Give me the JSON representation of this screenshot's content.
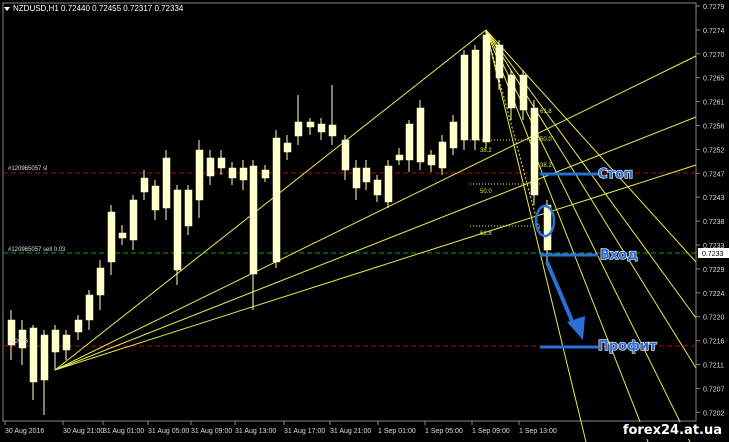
{
  "header": {
    "symbol": "NZDUSD,H1",
    "ohlc": "0.72440 0.72455 0.72317 0.72334"
  },
  "price_axis": {
    "ticks": [
      "0.7279",
      "0.7274",
      "0.7270",
      "0.7265",
      "0.7261",
      "0.7256",
      "0.7252",
      "0.7247",
      "0.7243",
      "0.7238",
      "0.7233",
      "0.7229",
      "0.7224",
      "0.7220",
      "0.7216",
      "0.7211",
      "0.7207",
      "0.7202"
    ],
    "current_price": "0.7233"
  },
  "time_axis": {
    "ticks": [
      "30 Aug 2016",
      "30 Aug 21:00",
      "31 Aug 01:00",
      "31 Aug 05:00",
      "31 Aug 09:00",
      "31 Aug 13:00",
      "31 Aug 17:00",
      "31 Aug 21:00",
      "1 Sep 01:00",
      "1 Sep 05:00",
      "1 Sep 09:00",
      "1 Sep 13:00"
    ]
  },
  "order_lines": {
    "stop_ticket": "#120965057 sl",
    "entry_ticket": "#120965057 sell 0.03",
    "profit_ticket": "#12096"
  },
  "annotations": {
    "stop_label": "Стоп",
    "entry_label": "Вход",
    "profit_label": "Профит"
  },
  "fib_levels": {
    "upper": [
      "38.2",
      "50.0",
      "61.8"
    ],
    "lower": [
      "38.2",
      "50.0",
      "61.8"
    ]
  },
  "watermark": "forex24.at.ua",
  "colors": {
    "background": "#000000",
    "candle": "#ffffcc",
    "fan_lines": "#ffff66",
    "stop_line": "#cc0000",
    "entry_line": "#00aa00",
    "annotation": "#2a6fd6",
    "trend_dots": "#4060ff"
  }
}
